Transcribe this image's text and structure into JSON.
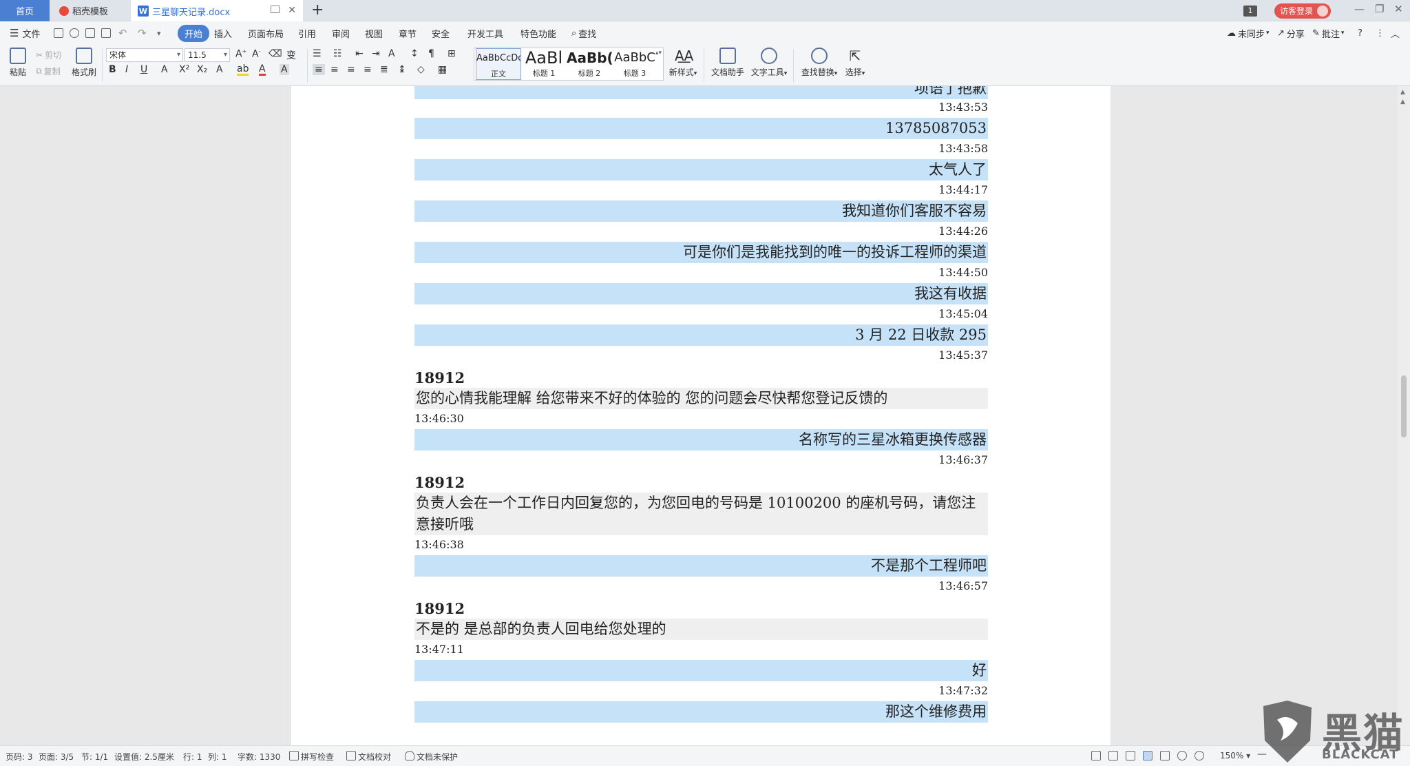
{
  "tabs": {
    "home": "首页",
    "template": "稻壳模板",
    "document": "三星聊天记录.docx",
    "add": "+",
    "doc_logo": "W",
    "page_count_badge": "1",
    "login": "访客登录"
  },
  "menu": {
    "file": "文件",
    "items": [
      "开始",
      "插入",
      "页面布局",
      "引用",
      "审阅",
      "视图",
      "章节",
      "安全",
      "开发工具",
      "特色功能"
    ],
    "search": "查找",
    "sync": "未同步",
    "share": "分享",
    "comment": "批注"
  },
  "ribbon": {
    "paste": "粘贴",
    "cut": "剪切",
    "copy": "复制",
    "format_painter": "格式刷",
    "font_name": "宋体",
    "font_size": "11.5",
    "styles": [
      {
        "preview": "AaBbCcDd",
        "name": "正文"
      },
      {
        "preview": "AaBl",
        "name": "标题 1"
      },
      {
        "preview": "AaBb(",
        "name": "标题 2"
      },
      {
        "preview": "AaBbC",
        "name": "标题 3"
      }
    ],
    "new_style": "新样式",
    "doc_assistant": "文档助手",
    "text_tools": "文字工具",
    "find_replace": "查找替换",
    "select": "选择"
  },
  "chat": {
    "partial_top": "项语了抱歉",
    "messages": [
      {
        "type": "time",
        "align": "right",
        "text": "13:43:53"
      },
      {
        "type": "me",
        "text": "13785087053"
      },
      {
        "type": "time",
        "align": "right",
        "text": "13:43:58"
      },
      {
        "type": "me",
        "text": "太气人了"
      },
      {
        "type": "time",
        "align": "right",
        "text": "13:44:17"
      },
      {
        "type": "me",
        "text": "我知道你们客服不容易"
      },
      {
        "type": "time",
        "align": "right",
        "text": "13:44:26"
      },
      {
        "type": "me",
        "text": "可是你们是我能找到的唯一的投诉工程师的渠道"
      },
      {
        "type": "time",
        "align": "right",
        "text": "13:44:50"
      },
      {
        "type": "me",
        "text": "我这有收据"
      },
      {
        "type": "time",
        "align": "right",
        "text": "13:45:04"
      },
      {
        "type": "me",
        "text": "3 月 22 日收款 295"
      },
      {
        "type": "time",
        "align": "right",
        "text": "13:45:37"
      },
      {
        "type": "sender",
        "text": "18912"
      },
      {
        "type": "them",
        "text": "您的心情我能理解  给您带来不好的体验的  您的问题会尽快帮您登记反馈的"
      },
      {
        "type": "time",
        "align": "left",
        "text": "13:46:30"
      },
      {
        "type": "me",
        "text": "名称写的三星冰箱更换传感器"
      },
      {
        "type": "time",
        "align": "right",
        "text": "13:46:37"
      },
      {
        "type": "sender",
        "text": "18912"
      },
      {
        "type": "them",
        "text": "负责人会在一个工作日内回复您的，为您回电的号码是 10100200 的座机号码，请您注意接听哦"
      },
      {
        "type": "time",
        "align": "left",
        "text": "13:46:38"
      },
      {
        "type": "me",
        "text": "不是那个工程师吧"
      },
      {
        "type": "time",
        "align": "right",
        "text": "13:46:57"
      },
      {
        "type": "sender",
        "text": "18912"
      },
      {
        "type": "them",
        "text": "不是的  是总部的负责人回电给您处理的"
      },
      {
        "type": "time",
        "align": "left",
        "text": "13:47:11"
      },
      {
        "type": "me",
        "text": "好"
      },
      {
        "type": "time",
        "align": "right",
        "text": "13:47:32"
      },
      {
        "type": "me",
        "text": "那这个维修费用"
      }
    ]
  },
  "status": {
    "page_code": "页码: 3",
    "pages": "页面: 3/5",
    "section": "节: 1/1",
    "setting": "设置值: 2.5厘米",
    "row": "行: 1",
    "col": "列: 1",
    "word_count": "字数: 1330",
    "spell_check": "拼写检查",
    "proofread": "文档校对",
    "protect": "文档未保护",
    "zoom": "150%"
  },
  "watermark": {
    "big": "黑猫",
    "small": "BLACKCAT"
  }
}
